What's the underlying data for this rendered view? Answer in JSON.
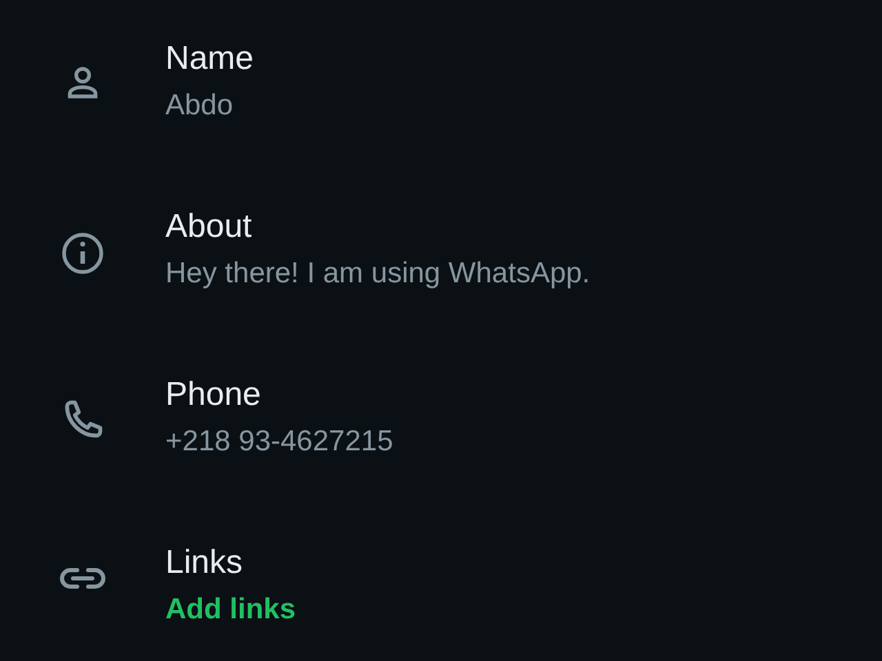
{
  "rows": [
    {
      "kind": "person",
      "label": "Name",
      "value": "Abdo",
      "accent": false
    },
    {
      "kind": "info",
      "label": "About",
      "value": "Hey there! I am using WhatsApp.",
      "accent": false
    },
    {
      "kind": "phone",
      "label": "Phone",
      "value": "+218 93-4627215",
      "accent": false
    },
    {
      "kind": "link",
      "label": "Links",
      "value": "Add links",
      "accent": true
    }
  ]
}
